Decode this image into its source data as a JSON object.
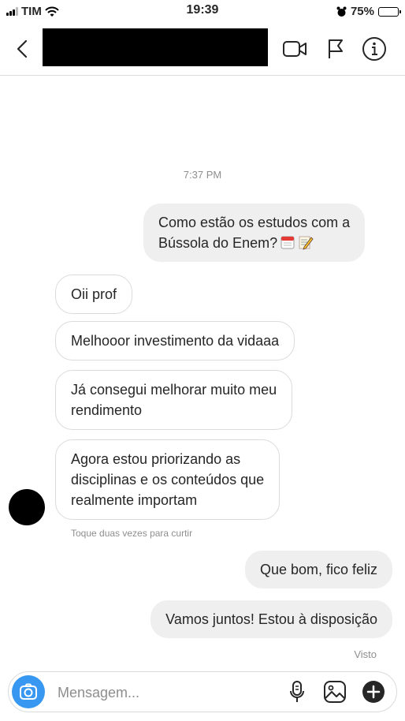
{
  "status_bar": {
    "carrier": "TIM",
    "time": "19:39",
    "battery": "75%"
  },
  "header": {
    "icons": [
      "back-icon",
      "video-call-icon",
      "flag-icon",
      "info-icon"
    ]
  },
  "chat": {
    "timestamp": "7:37 PM",
    "messages": [
      {
        "from": "me",
        "lines": [
          "Como estão os estudos com a",
          "Bússola do Enem?"
        ],
        "emoji": [
          "calendar-icon",
          "memo-icon"
        ]
      },
      {
        "from": "them",
        "lines": [
          "Oii prof"
        ]
      },
      {
        "from": "them",
        "lines": [
          "Melhooor investimento da vidaaa"
        ]
      },
      {
        "from": "them",
        "lines": [
          "Já consegui melhorar muito meu",
          "rendimento"
        ]
      },
      {
        "from": "them",
        "lines": [
          "Agora estou priorizando as",
          "disciplinas e os conteúdos que",
          "realmente importam"
        ]
      },
      {
        "from": "me",
        "lines": [
          "Que bom, fico feliz"
        ]
      },
      {
        "from": "me",
        "lines": [
          "Vamos juntos! Estou à disposição"
        ]
      }
    ],
    "double_tap_hint": "Toque duas vezes para curtir",
    "seen_label": "Visto"
  },
  "composer": {
    "placeholder": "Mensagem...",
    "icons": [
      "camera-icon",
      "microphone-icon",
      "gallery-icon",
      "plus-icon"
    ]
  }
}
